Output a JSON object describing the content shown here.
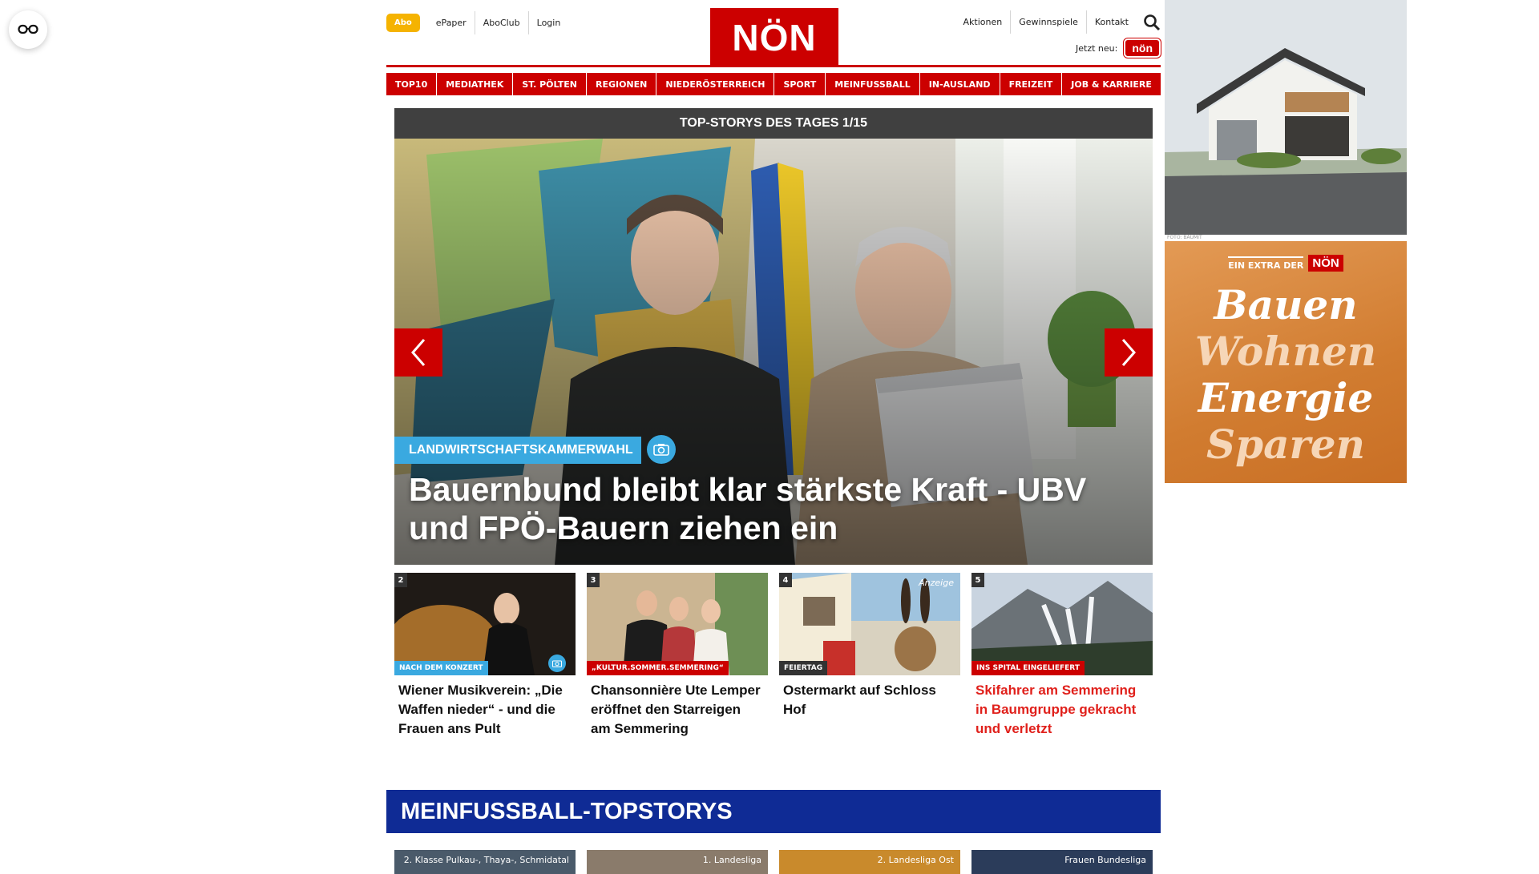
{
  "header": {
    "abo_label": "Abo",
    "links": [
      "ePaper",
      "AboClub",
      "Login"
    ],
    "logo": "NÖN",
    "right_links": [
      "Aktionen",
      "Gewinnspiele",
      "Kontakt"
    ],
    "jetzt_neu": "Jetzt neu:",
    "app_badge": "nön"
  },
  "nav": [
    "TOP10",
    "MEDIATHEK",
    "ST. PÖLTEN",
    "REGIONEN",
    "NIEDERÖSTERREICH",
    "SPORT",
    "MEINFUSSBALL",
    "IN-AUSLAND",
    "FREIZEIT",
    "JOB & KARRIERE"
  ],
  "hero": {
    "heading": "TOP-STORYS DES TAGES 1/15",
    "tag": "LANDWIRTSCHAFTSKAMMERWAHL",
    "title": "Bauernbund bleibt klar stärkste Kraft - UBV und FPÖ-Bauern ziehen ein"
  },
  "teasers": [
    {
      "num": "2",
      "badge": "NACH DEM KONZERT",
      "badge_color": "#3aa9e0",
      "title": "Wiener Musikverein: „Die Waffen nieder“ - und die Frauen ans Pult",
      "red": false
    },
    {
      "num": "3",
      "badge": "„KULTUR.SOMMER.SEMMERING“",
      "badge_color": "#cc0000",
      "title": "Chansonnière Ute Lemper eröffnet den Starreigen am Semmering",
      "red": false
    },
    {
      "num": "4",
      "badge": "FEIERTAG",
      "badge_color": "#333333",
      "anzeige": "Anzeige",
      "title": "Ostermarkt auf Schloss Hof",
      "red": false
    },
    {
      "num": "5",
      "badge": "INS SPITAL EINGELIEFERT",
      "badge_color": "#cc0000",
      "title": "Skifahrer am Semmering in Baumgruppe gekracht und verletzt",
      "red": true
    }
  ],
  "mfb": {
    "title": "MEINFUSSBALL-TOPSTORYS",
    "cards": [
      "2. Klasse Pulkau-, Thaya-, Schmidatal",
      "1. Landesliga",
      "2. Landesliga Ost",
      "Frauen Bundesliga"
    ]
  },
  "ads": {
    "credit": "FOTO: BAUMIT",
    "extra_text": "EIN EXTRA DER",
    "extra_logo": "NÖN",
    "words": [
      "Bauen",
      "Wohnen",
      "Energie",
      "Sparen"
    ]
  }
}
